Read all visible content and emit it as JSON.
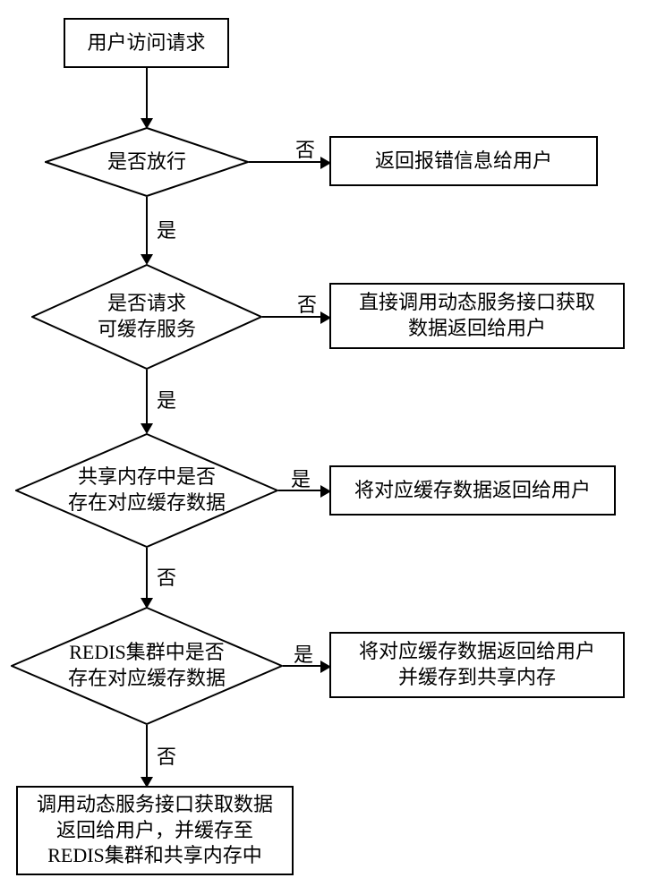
{
  "nodes": {
    "start": "用户访问请求",
    "d1": "是否放行",
    "r1": "返回报错信息给用户",
    "d2_line1": "是否请求",
    "d2_line2": "可缓存服务",
    "r2_line1": "直接调用动态服务接口获取",
    "r2_line2": "数据返回给用户",
    "d3_line1": "共享内存中是否",
    "d3_line2": "存在对应缓存数据",
    "r3": "将对应缓存数据返回给用户",
    "d4_line1": "REDIS集群中是否",
    "d4_line2": "存在对应缓存数据",
    "r4_line1": "将对应缓存数据返回给用户",
    "r4_line2": "并缓存到共享内存",
    "end_line1": "调用动态服务接口获取数据",
    "end_line2": "返回给用户，并缓存至",
    "end_line3": "REDIS集群和共享内存中"
  },
  "labels": {
    "yes": "是",
    "no": "否"
  }
}
